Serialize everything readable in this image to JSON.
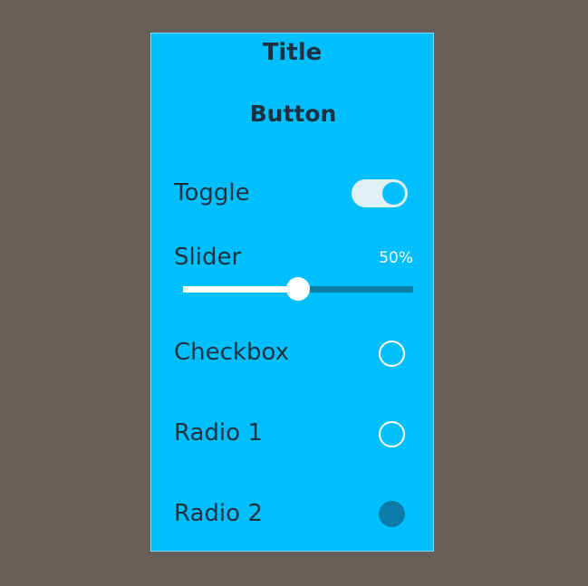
{
  "panel": {
    "title": "Title",
    "button_label": "Button",
    "toggle": {
      "label": "Toggle",
      "on": true
    },
    "slider": {
      "label": "Slider",
      "value_text": "50%",
      "value": 0.5
    },
    "checkbox": {
      "label": "Checkbox",
      "checked": false
    },
    "radio1": {
      "label": "Radio 1",
      "selected": false
    },
    "radio2": {
      "label": "Radio 2",
      "selected": true
    }
  },
  "colors": {
    "background": "#675f59",
    "panel": "#00bfff",
    "text": "#1c3140",
    "track_dark": "#0a7fa6",
    "radio_filled": "#0b7ba8"
  }
}
